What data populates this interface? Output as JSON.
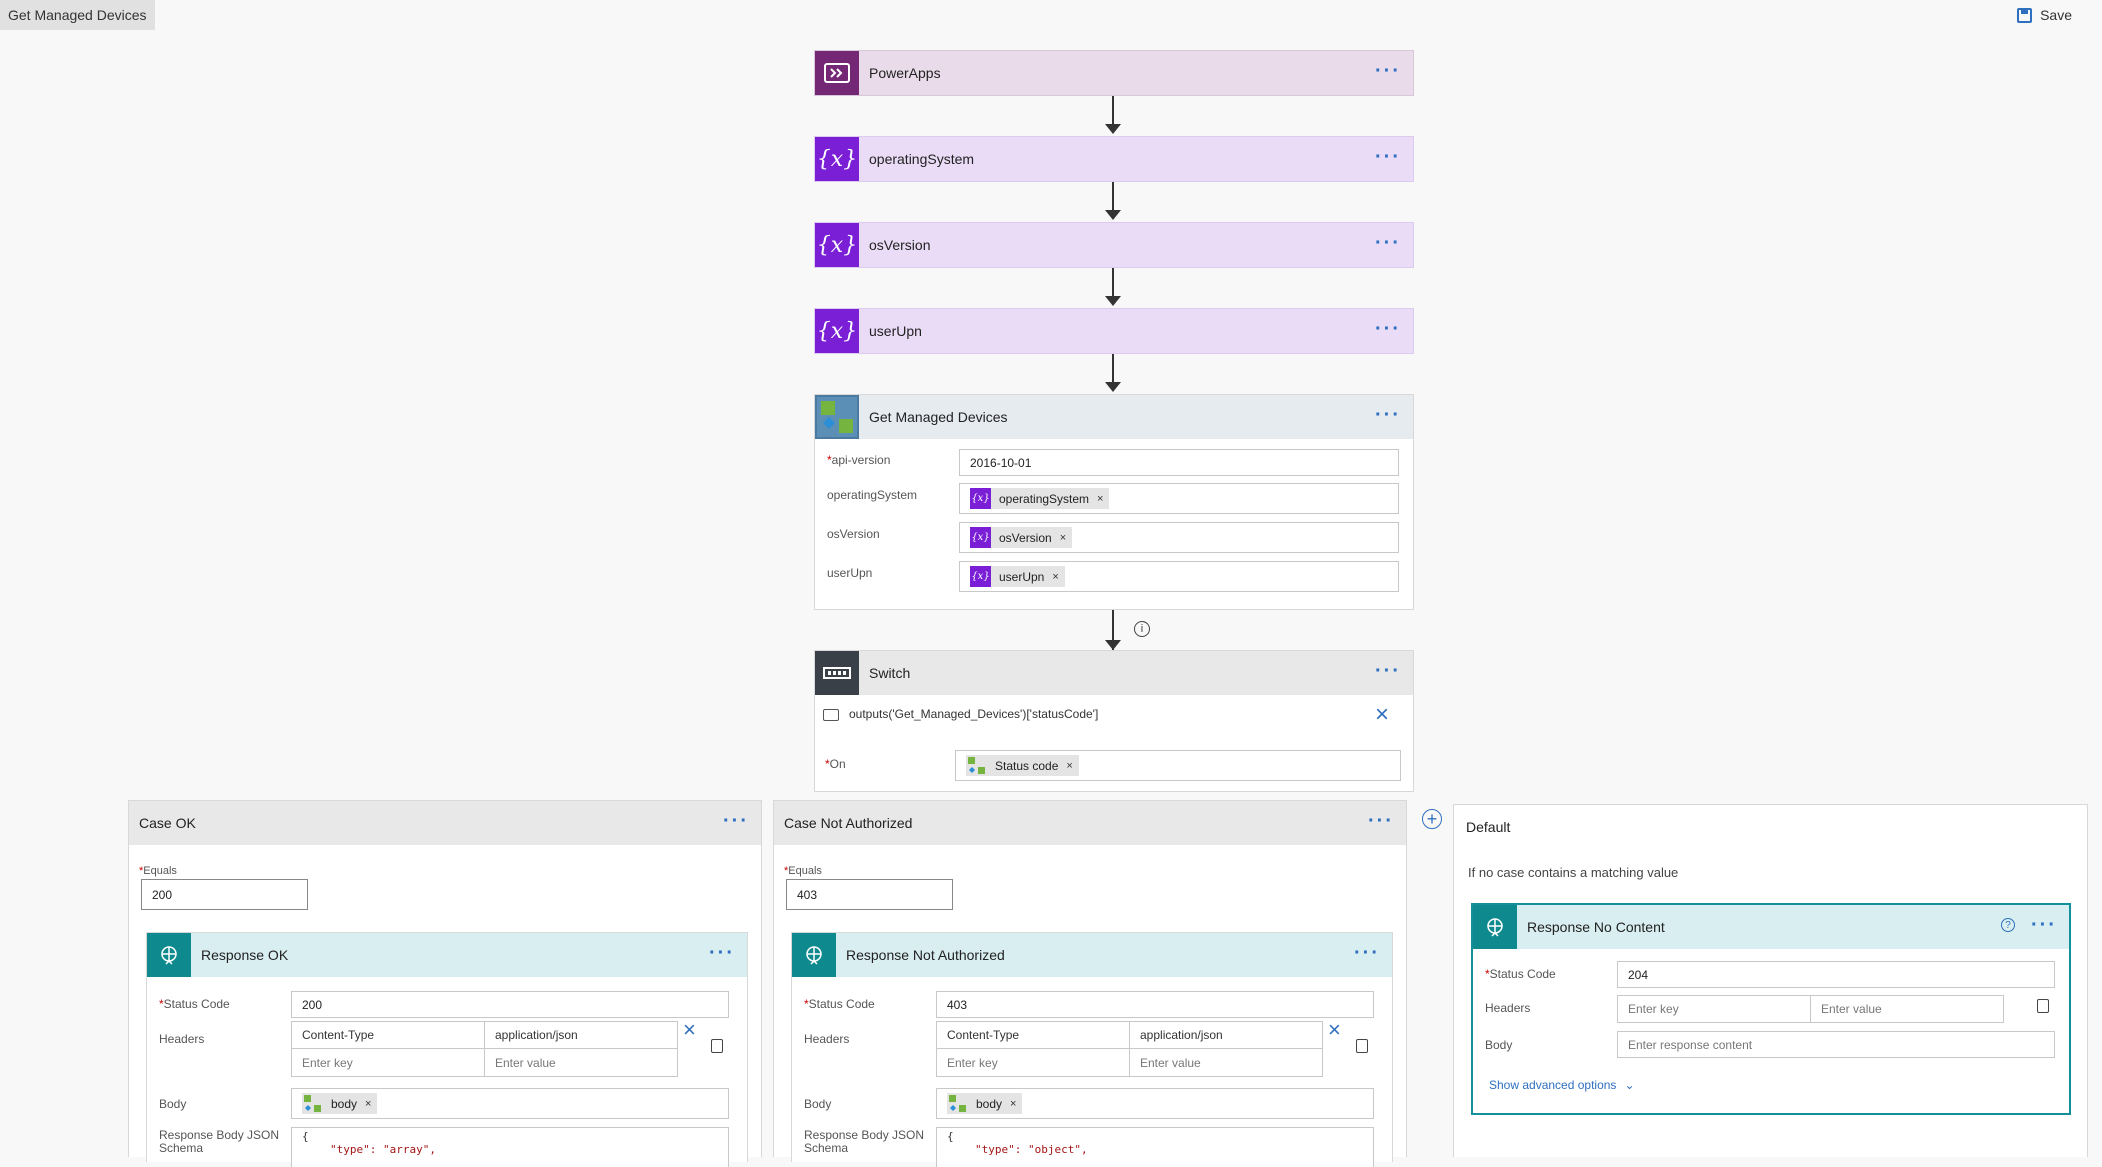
{
  "window": {
    "title": "Get Managed Devices",
    "save_label": "Save"
  },
  "steps": {
    "powerapps": {
      "title": "PowerApps"
    },
    "operatingSystem": {
      "title": "operatingSystem"
    },
    "osVersion": {
      "title": "osVersion"
    },
    "userUpn": {
      "title": "userUpn"
    },
    "variable_icon": "{x}"
  },
  "get_devices": {
    "title": "Get Managed Devices",
    "fields": {
      "api_version_label": "api-version",
      "api_version_value": "2016-10-01",
      "operatingSystem_label": "operatingSystem",
      "operatingSystem_token": "operatingSystem",
      "osVersion_label": "osVersion",
      "osVersion_token": "osVersion",
      "userUpn_label": "userUpn",
      "userUpn_token": "userUpn"
    }
  },
  "switch": {
    "title": "Switch",
    "expression": "outputs('Get_Managed_Devices')['statusCode']",
    "on_label": "On",
    "on_token": "Status code"
  },
  "case_ok": {
    "title": "Case OK",
    "equals_label": "Equals",
    "equals_value": "200",
    "response": {
      "title": "Response OK",
      "status_code_label": "Status Code",
      "status_code": "200",
      "headers_label": "Headers",
      "header_key": "Content-Type",
      "header_value": "application/json",
      "key_placeholder": "Enter key",
      "value_placeholder": "Enter value",
      "body_label": "Body",
      "body_token": "body",
      "schema_label": "Response Body JSON Schema",
      "schema_line1": "{",
      "schema_line2": "\"type\": \"array\","
    }
  },
  "case_not_authorized": {
    "title": "Case Not Authorized",
    "equals_label": "Equals",
    "equals_value": "403",
    "response": {
      "title": "Response Not Authorized",
      "status_code_label": "Status Code",
      "status_code": "403",
      "headers_label": "Headers",
      "header_key": "Content-Type",
      "header_value": "application/json",
      "key_placeholder": "Enter key",
      "value_placeholder": "Enter value",
      "body_label": "Body",
      "body_token": "body",
      "schema_label": "Response Body JSON Schema",
      "schema_line1": "{",
      "schema_line2": "\"type\": \"object\","
    }
  },
  "default_case": {
    "title": "Default",
    "description": "If no case contains a matching value",
    "response": {
      "title": "Response No Content",
      "status_code_label": "Status Code",
      "status_code": "204",
      "headers_label": "Headers",
      "key_placeholder": "Enter key",
      "value_placeholder": "Enter value",
      "body_label": "Body",
      "body_placeholder": "Enter response content",
      "advanced_label": "Show advanced options"
    }
  },
  "colors": {
    "accent": "#2f6fbf",
    "variable_purple": "#7a1fd6",
    "powerapps_purple": "#742774",
    "response_teal": "#0e8a8f"
  }
}
